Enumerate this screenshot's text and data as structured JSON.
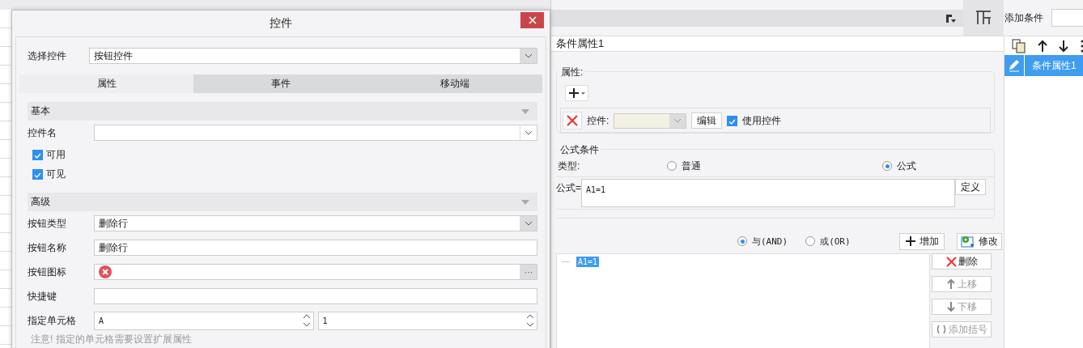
{
  "dialog": {
    "title": "控件",
    "select_control": {
      "label": "选择控件",
      "value": "按钮控件"
    },
    "tabs": [
      {
        "label": "属性",
        "selected": true
      },
      {
        "label": "事件",
        "selected": false
      },
      {
        "label": "移动端",
        "selected": false
      }
    ],
    "sections": [
      {
        "title": "基本",
        "rows": [
          {
            "kind": "combo",
            "label": "控件名"
          },
          {
            "kind": "checkbox",
            "label": "可用",
            "checked": true
          },
          {
            "kind": "checkbox",
            "label": "可见",
            "checked": true
          }
        ]
      },
      {
        "title": "高级",
        "rows": [
          {
            "kind": "select",
            "label": "按钮类型",
            "value": "删除行"
          },
          {
            "kind": "text",
            "label": "按钮名称",
            "value": "删除行"
          },
          {
            "kind": "icon_picker",
            "label": "按钮图标",
            "button": "···"
          },
          {
            "kind": "text",
            "label": "快捷键"
          },
          {
            "kind": "spinners",
            "label": "指定单元格",
            "values": [
              "A",
              "1"
            ]
          }
        ]
      }
    ],
    "note": "注意! 指定的单元格需要设置扩展属性"
  },
  "condition_panel": {
    "header": "条件属性1",
    "properties_group": {
      "title": "属性:",
      "control_label": "控件:",
      "edit_button": "编辑",
      "use_control": {
        "label": "使用控件",
        "checked": true
      }
    },
    "formula_group": {
      "title": "公式条件",
      "type_label": "类型:",
      "type_options": [
        {
          "label": "普通",
          "selected": false
        },
        {
          "label": "公式",
          "selected": true
        }
      ],
      "formula_label": "公式=",
      "formula": "A1=1",
      "define_button": "定义"
    },
    "logic_options": [
      {
        "label": "与(AND)",
        "selected": true
      },
      {
        "label": "或(OR)",
        "selected": false
      }
    ],
    "add_button": "增加",
    "modify_button": "修改",
    "conditions": [
      {
        "text": "A1=1",
        "selected": true
      }
    ],
    "side_buttons": [
      {
        "label": "删除",
        "disabled": false
      },
      {
        "label": "上移",
        "disabled": true
      },
      {
        "label": "下移",
        "disabled": true
      },
      {
        "label": "添加括号",
        "disabled": true
      }
    ]
  },
  "right_panel": {
    "add_condition_label": "添加条件",
    "list_items": [
      {
        "label": "条件属性1",
        "selected": true
      }
    ]
  }
}
